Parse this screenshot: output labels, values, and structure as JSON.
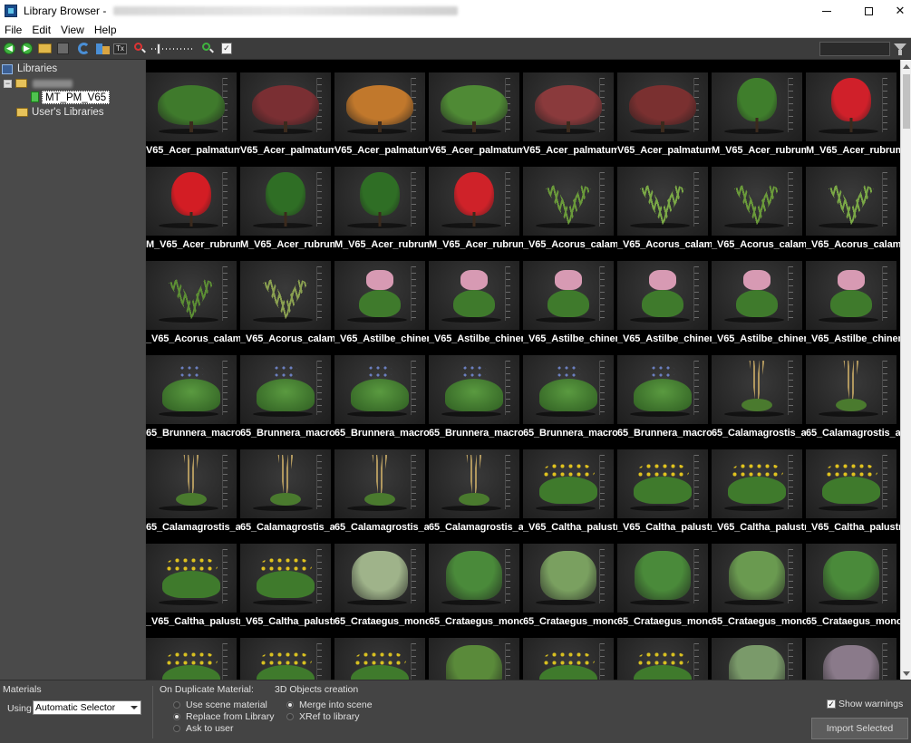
{
  "window": {
    "title": "Library Browser -"
  },
  "menu": [
    "File",
    "Edit",
    "View",
    "Help"
  ],
  "tree": {
    "root_label": "Libraries",
    "selected_library": "MT_PM_V65",
    "user_libraries": "User's Libraries"
  },
  "thumbnails": [
    {
      "label": "V65_Acer_palmatum_v",
      "kind": "shrub",
      "color": "#3f7a2c"
    },
    {
      "label": "V65_Acer_palmatum_v",
      "kind": "shrub",
      "color": "#7a2f33"
    },
    {
      "label": "V65_Acer_palmatum_v",
      "kind": "shrub",
      "color": "#c1782c"
    },
    {
      "label": "V65_Acer_palmatum_v",
      "kind": "shrub",
      "color": "#4f8a35"
    },
    {
      "label": "V65_Acer_palmatum_v",
      "kind": "shrub",
      "color": "#8a3a3c"
    },
    {
      "label": "V65_Acer_palmatum_v",
      "kind": "shrub",
      "color": "#7a3030"
    },
    {
      "label": "M_V65_Acer_rubrum_l",
      "kind": "tree",
      "color": "#3f7e2c"
    },
    {
      "label": "M_V65_Acer_rubrum_l",
      "kind": "tree",
      "color": "#d0202a"
    },
    {
      "label": "M_V65_Acer_rubrum_l",
      "kind": "tree",
      "color": "#d31d24"
    },
    {
      "label": "M_V65_Acer_rubrum_l",
      "kind": "tree",
      "color": "#2f6e25"
    },
    {
      "label": "M_V65_Acer_rubrum_l",
      "kind": "tree",
      "color": "#2f6e25"
    },
    {
      "label": "M_V65_Acer_rubrum_l",
      "kind": "tree",
      "color": "#cf2229"
    },
    {
      "label": "_V65_Acorus_calamus",
      "kind": "grass",
      "color": "#6a9a3a"
    },
    {
      "label": "_V65_Acorus_calamus",
      "kind": "grass",
      "color": "#7aa846"
    },
    {
      "label": "_V65_Acorus_calamus",
      "kind": "grass",
      "color": "#6a9a3a"
    },
    {
      "label": "_V65_Acorus_calamus",
      "kind": "grass",
      "color": "#7aa846"
    },
    {
      "label": "_V65_Acorus_calamus",
      "kind": "grass",
      "color": "#5c8e34"
    },
    {
      "label": "_V65_Acorus_calamus",
      "kind": "grass",
      "color": "#8aa050"
    },
    {
      "label": "_V65_Astilbe_chinensi",
      "kind": "flower",
      "color": "#d79ab3"
    },
    {
      "label": "_V65_Astilbe_chinensi",
      "kind": "flower",
      "color": "#d79ab3"
    },
    {
      "label": "_V65_Astilbe_chinensi",
      "kind": "flower",
      "color": "#d79ab3"
    },
    {
      "label": "_V65_Astilbe_chinensi",
      "kind": "flower",
      "color": "#d79ab3"
    },
    {
      "label": "_V65_Astilbe_chinensi",
      "kind": "flower",
      "color": "#d79ab3"
    },
    {
      "label": "_V65_Astilbe_chinensi",
      "kind": "flower",
      "color": "#d79ab3"
    },
    {
      "label": "65_Brunnera_macroph",
      "kind": "leafy",
      "color": "#5a9a40"
    },
    {
      "label": "65_Brunnera_macroph",
      "kind": "leafy",
      "color": "#5a9a40"
    },
    {
      "label": "65_Brunnera_macroph",
      "kind": "leafy",
      "color": "#5a9a40"
    },
    {
      "label": "65_Brunnera_macroph",
      "kind": "leafy",
      "color": "#5a9a40"
    },
    {
      "label": "65_Brunnera_macroph",
      "kind": "leafy",
      "color": "#5a9a40"
    },
    {
      "label": "65_Brunnera_macroph",
      "kind": "leafy",
      "color": "#5a9a40"
    },
    {
      "label": "65_Calamagrostis_acuti",
      "kind": "plume",
      "color": "#b0975e"
    },
    {
      "label": "65_Calamagrostis_acuti",
      "kind": "plume",
      "color": "#b0975e"
    },
    {
      "label": "65_Calamagrostis_acuti",
      "kind": "plume",
      "color": "#b0975e"
    },
    {
      "label": "65_Calamagrostis_acuti",
      "kind": "plume",
      "color": "#b0975e"
    },
    {
      "label": "65_Calamagrostis_acuti",
      "kind": "plume",
      "color": "#b0975e"
    },
    {
      "label": "65_Calamagrostis_acuti",
      "kind": "plume",
      "color": "#b0975e"
    },
    {
      "label": "_V65_Caltha_palustris",
      "kind": "yellow",
      "color": "#e0c21e"
    },
    {
      "label": "_V65_Caltha_palustris",
      "kind": "yellow",
      "color": "#e0c21e"
    },
    {
      "label": "_V65_Caltha_palustris",
      "kind": "yellow",
      "color": "#e0c21e"
    },
    {
      "label": "_V65_Caltha_palustris",
      "kind": "yellow",
      "color": "#e0c21e"
    },
    {
      "label": "_V65_Caltha_palustris",
      "kind": "yellow",
      "color": "#e0c21e"
    },
    {
      "label": "_V65_Caltha_palustris",
      "kind": "yellow",
      "color": "#e0c21e"
    },
    {
      "label": "65_Crataegus_monogy",
      "kind": "bush",
      "color": "#9fb38a"
    },
    {
      "label": "65_Crataegus_monogy",
      "kind": "bush",
      "color": "#4a8a3a"
    },
    {
      "label": "65_Crataegus_monogy",
      "kind": "bush",
      "color": "#7aa060"
    },
    {
      "label": "65_Crataegus_monogy",
      "kind": "bush",
      "color": "#4a8a3a"
    },
    {
      "label": "65_Crataegus_monogy",
      "kind": "bush",
      "color": "#6a9a50"
    },
    {
      "label": "65_Crataegus_monogy",
      "kind": "bush",
      "color": "#4a8a3a"
    },
    {
      "label": "",
      "kind": "yellow",
      "color": "#d8c020"
    },
    {
      "label": "",
      "kind": "yellow",
      "color": "#d8c020"
    },
    {
      "label": "",
      "kind": "yellow",
      "color": "#d8c020"
    },
    {
      "label": "",
      "kind": "bush",
      "color": "#5a8a3a"
    },
    {
      "label": "",
      "kind": "yellow",
      "color": "#d8c020"
    },
    {
      "label": "",
      "kind": "yellow",
      "color": "#d8c020"
    },
    {
      "label": "",
      "kind": "bush",
      "color": "#7a9a6a"
    },
    {
      "label": "",
      "kind": "bush",
      "color": "#8a7a8a"
    }
  ],
  "bottom": {
    "materials_title": "Materials",
    "using_label": "Using",
    "selector_value": "Automatic Selector",
    "duplicate_title": "On Duplicate Material:",
    "duplicate_options": [
      "Use scene material",
      "Replace from Library",
      "Ask to user"
    ],
    "duplicate_selected": 1,
    "creation_title": "3D Objects creation",
    "creation_options": [
      "Merge into scene",
      "XRef to library"
    ],
    "creation_selected": 0,
    "show_warnings_label": "Show warnings",
    "show_warnings_checked": true,
    "import_button": "Import Selected"
  },
  "icons": {
    "back": "back-arrow-icon",
    "forward": "forward-arrow-icon",
    "folder": "open-folder-icon",
    "refresh": "refresh-icon",
    "zoom_out": "zoom-out-icon",
    "zoom_in": "zoom-in-icon",
    "filter": "filter-icon"
  }
}
